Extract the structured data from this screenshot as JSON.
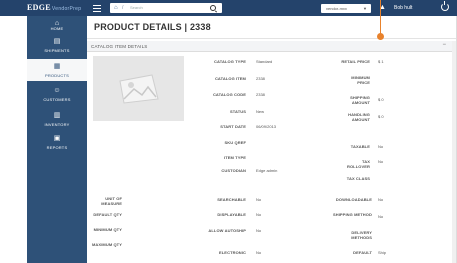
{
  "topbar": {
    "logo_main": "EDGE",
    "logo_sub": "VendorPrep",
    "search_placeholder": "Search",
    "dropdown_value": "vendor-mxx",
    "user_name": "Bob hult"
  },
  "sidebar": {
    "items": [
      {
        "label": "HOME",
        "icon": "home-icon",
        "glyph": "⌂"
      },
      {
        "label": "SHIPMENTS",
        "icon": "shipments-icon",
        "glyph": "▤"
      },
      {
        "label": "PRODUCTS",
        "icon": "products-icon",
        "glyph": "▦"
      },
      {
        "label": "CUSTOMERS",
        "icon": "customers-icon",
        "glyph": "☺"
      },
      {
        "label": "INVENTORY",
        "icon": "inventory-icon",
        "glyph": "▥"
      },
      {
        "label": "REPORTS",
        "icon": "reports-icon",
        "glyph": "▣"
      }
    ],
    "active_index": 2
  },
  "page": {
    "title": "PRODUCT DETAILS | 2338",
    "panel_title": "CATALOG ITEM DETAILS",
    "panel_toggle": "−"
  },
  "details_center": [
    {
      "label": "CATALOG TYPE",
      "value": "Standard"
    },
    {
      "label": "CATALOG ITEM",
      "value": "2338"
    },
    {
      "label": "CATALOG CODE",
      "value": "2338"
    },
    {
      "label": "STATUS",
      "value": "New"
    },
    {
      "label": "START DATE",
      "value": "06/09/2013"
    },
    {
      "label": "SKU QREF",
      "value": ""
    },
    {
      "label": "ITEM TYPE",
      "value": ""
    },
    {
      "label": "CUSTODIAN",
      "value": "Edge admin"
    }
  ],
  "details_right": [
    {
      "label": "RETAIL PRICE",
      "value": "$ 1"
    },
    {
      "label": "MINIMUM PRICE",
      "value": ""
    },
    {
      "label": "SHIPPING AMOUNT",
      "value": "$ 0"
    },
    {
      "label": "HANDLING AMOUNT",
      "value": "$ 0"
    },
    {
      "label": "TAXABLE",
      "value": "No"
    },
    {
      "label": "TAX ROLLOVER",
      "value": "No"
    },
    {
      "label": "TAX CLASS",
      "value": ""
    }
  ],
  "details_lower_left": [
    {
      "label": "UNIT OF MEASURE",
      "value": ""
    },
    {
      "label": "DEFAULT QTY",
      "value": ""
    },
    {
      "label": "MINIMUM QTY",
      "value": ""
    },
    {
      "label": "MAXIMUM QTY",
      "value": ""
    }
  ],
  "details_lower_center": [
    {
      "label": "SEARCHABLE",
      "value": "No"
    },
    {
      "label": "DISPLAYABLE",
      "value": "No"
    },
    {
      "label": "ALLOW AUTOSHIP",
      "value": "No"
    },
    {
      "label": "ELECTRONIC",
      "value": "No"
    }
  ],
  "details_lower_right": [
    {
      "label": "DOWNLOADABLE",
      "value": "No"
    },
    {
      "label": "SHIPPING METHOD",
      "value": "No"
    },
    {
      "label": "DELIVERY METHODS",
      "value": ""
    },
    {
      "label": "DEFAULT",
      "value": "Ship"
    }
  ],
  "colors": {
    "topbar": "#24436b",
    "sidebar": "#2e5178",
    "accent_marker": "#e8822c"
  }
}
